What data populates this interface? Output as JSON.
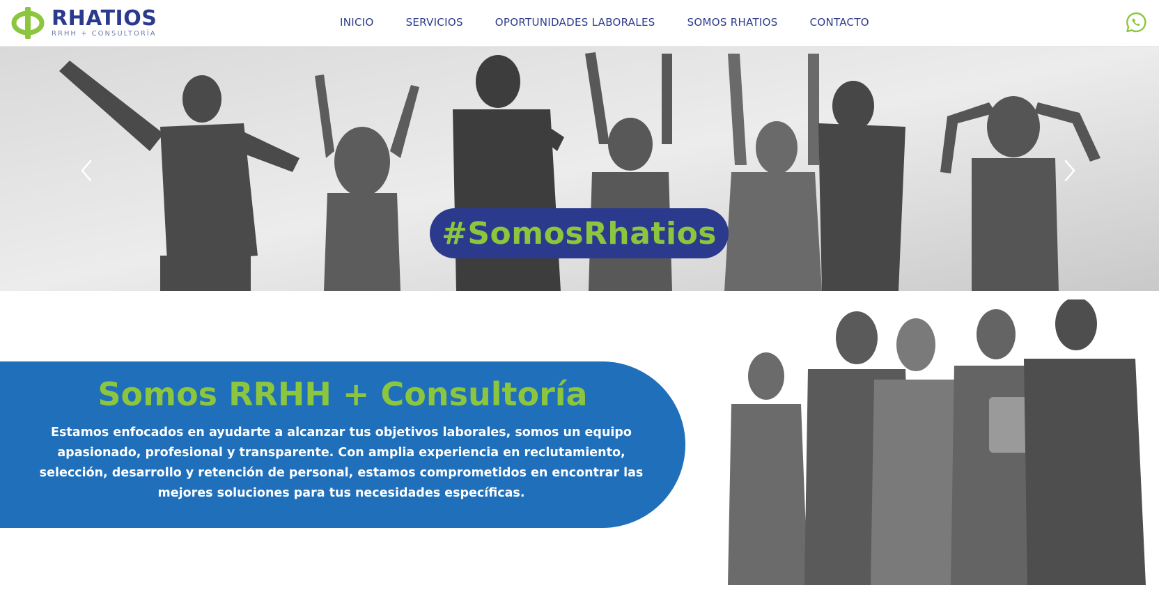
{
  "header": {
    "logo": {
      "name": "RHATIOS",
      "tagline": "RRHH + CONSULTORÍA",
      "icon": "phi-logo-icon"
    },
    "nav": [
      {
        "label": "INICIO"
      },
      {
        "label": "SERVICIOS"
      },
      {
        "label": "OPORTUNIDADES LABORALES"
      },
      {
        "label": "SOMOS RHATIOS"
      },
      {
        "label": "CONTACTO"
      }
    ],
    "whatsapp_icon": "whatsapp-icon"
  },
  "hero": {
    "hashtag": "#SomosRhatios",
    "prev_icon": "chevron-left-icon",
    "next_icon": "chevron-right-icon"
  },
  "about": {
    "title": "Somos RRHH + Consultoría",
    "text": "Estamos enfocados en ayudarte a alcanzar tus objetivos laborales, somos un equipo apasionado, profesional y transparente. Con amplia experiencia en reclutamiento, selección, desarrollo y retención de personal, estamos comprometidos en encontrar las mejores soluciones para tus necesidades específicas."
  },
  "colors": {
    "brand_blue": "#2b3a8c",
    "brand_green": "#8cc63f",
    "card_blue": "#1f6fba"
  }
}
